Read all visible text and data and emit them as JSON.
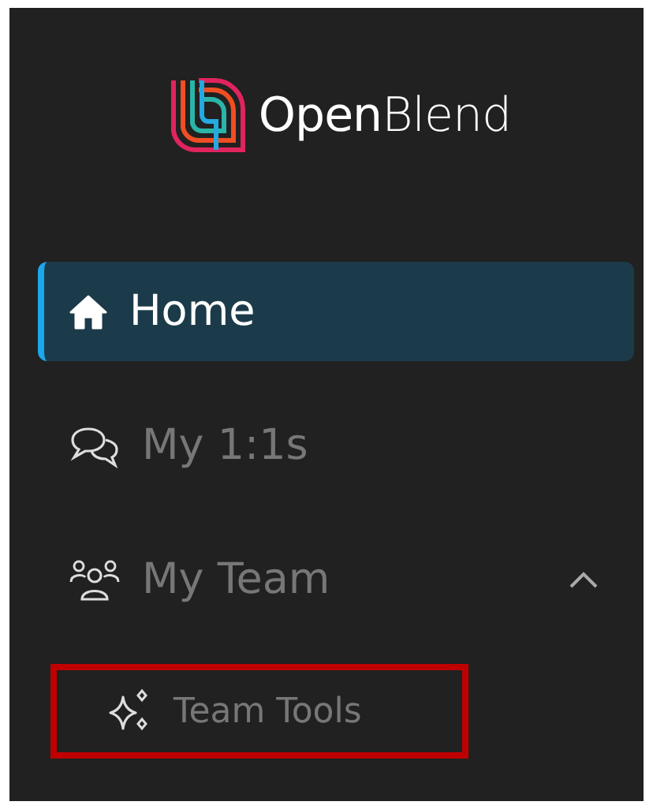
{
  "brand": {
    "name": "**Open**Blend"
  },
  "nav": [
    {
      "kind": "item",
      "label": "Home",
      "selected": true
    },
    {
      "kind": "item",
      "label": "My 1:1s",
      "selected": false
    },
    {
      "kind": "group",
      "label": "My Team",
      "selected": false,
      "expanded": true,
      "children": [
        {
          "kind": "subitem",
          "label": "Team Tools",
          "selected": false,
          "highlighted": true
        }
      ]
    }
  ]
}
